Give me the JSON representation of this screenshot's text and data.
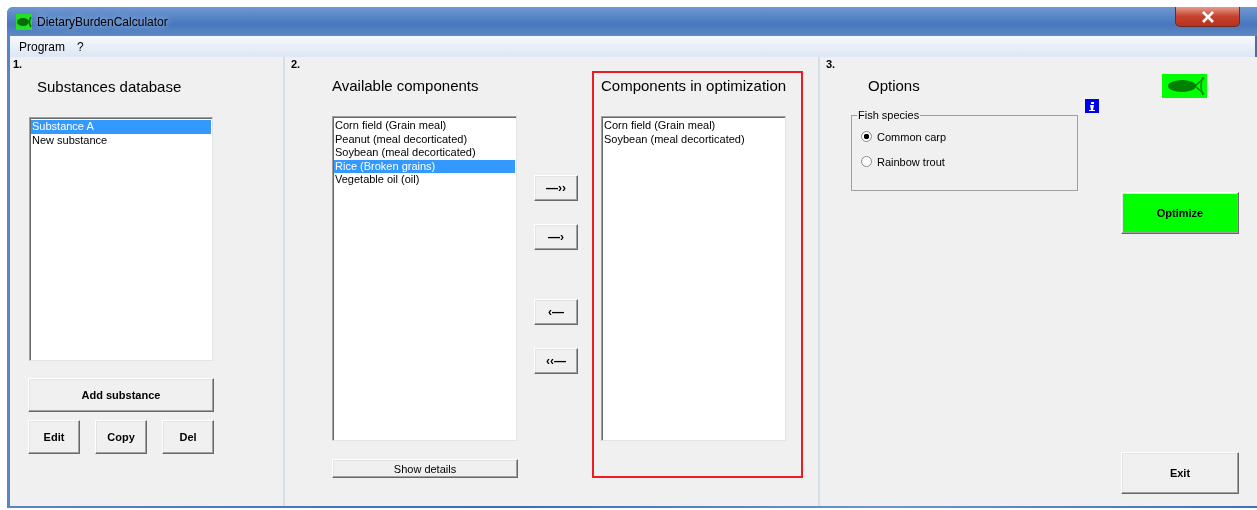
{
  "window": {
    "title": "DietaryBurdenCalculator"
  },
  "menu": [
    {
      "label": "Program"
    },
    {
      "label": "?"
    }
  ],
  "substances": {
    "step": "1.",
    "heading": "Substances database",
    "items": [
      {
        "label": "Substance A",
        "selected": true
      },
      {
        "label": "New substance",
        "selected": false
      }
    ],
    "add_button": "Add substance",
    "buttons": [
      "Edit",
      "Copy",
      "Del"
    ]
  },
  "components": {
    "step": "2.",
    "available_heading": "Available components",
    "available": [
      {
        "label": "Corn field (Grain meal)",
        "selected": false
      },
      {
        "label": "Peanut (meal decorticated)",
        "selected": false
      },
      {
        "label": "Soybean (meal decorticated)",
        "selected": false
      },
      {
        "label": "Rice (Broken grains)",
        "selected": true
      },
      {
        "label": "Vegetable oil (oil)",
        "selected": false
      }
    ],
    "show_details": "Show details",
    "transfer_buttons": [
      "—››",
      "—›",
      "‹—",
      "‹‹—"
    ],
    "optimization_heading": "Components in optimization",
    "optimization": [
      {
        "label": "Corn field (Grain meal)",
        "selected": false
      },
      {
        "label": "Soybean (meal decorticated)",
        "selected": false
      }
    ]
  },
  "options": {
    "step": "3.",
    "heading": "Options",
    "fish_species": {
      "legend": "Fish species",
      "options": [
        {
          "label": "Common carp",
          "selected": true
        },
        {
          "label": "Rainbow trout",
          "selected": false
        }
      ]
    },
    "optimize": "Optimize",
    "exit": "Exit"
  }
}
